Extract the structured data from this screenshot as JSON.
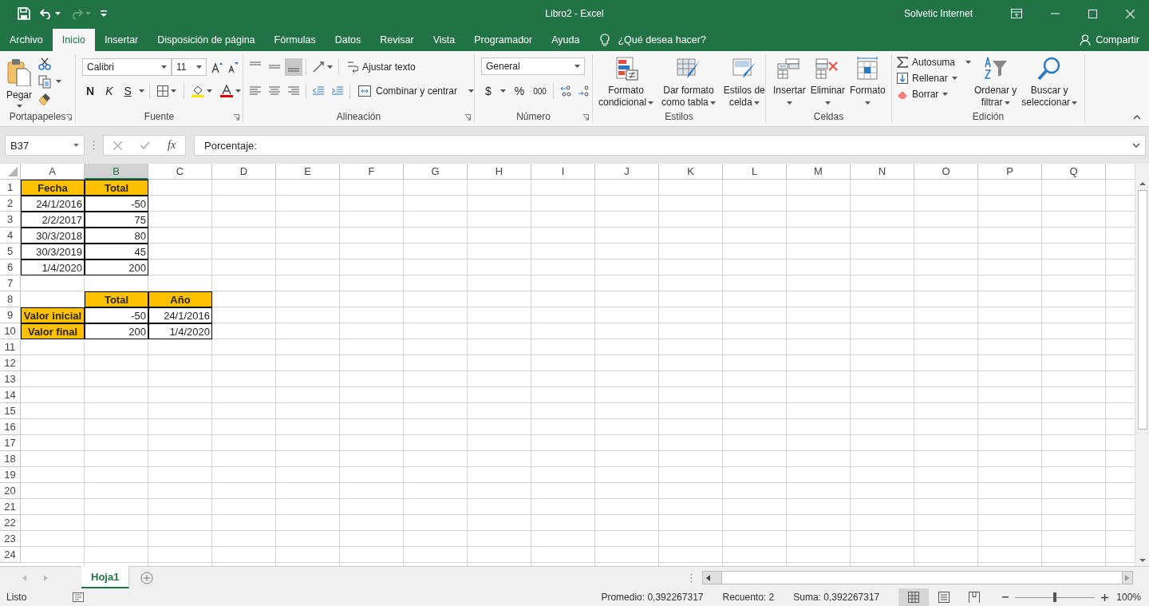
{
  "title_bar": {
    "title": "Libro2  -  Excel",
    "user": "Solvetic Internet",
    "redo_disabled": true
  },
  "menu_tabs": [
    {
      "label": "Archivo",
      "selected": false
    },
    {
      "label": "Inicio",
      "selected": true
    },
    {
      "label": "Insertar",
      "selected": false
    },
    {
      "label": "Disposición de página",
      "selected": false
    },
    {
      "label": "Fórmulas",
      "selected": false
    },
    {
      "label": "Datos",
      "selected": false
    },
    {
      "label": "Revisar",
      "selected": false
    },
    {
      "label": "Vista",
      "selected": false
    },
    {
      "label": "Programador",
      "selected": false
    },
    {
      "label": "Ayuda",
      "selected": false
    }
  ],
  "tell_me": {
    "placeholder": "¿Qué desea hacer?"
  },
  "share": "Compartir",
  "ribbon": {
    "groups": [
      {
        "kind": "clipboard",
        "label": "Portapapeles",
        "launcher": true,
        "paste": "Pegar"
      },
      {
        "kind": "font",
        "label": "Fuente",
        "launcher": true,
        "font_name": "Calibri",
        "font_size": "11",
        "bold": "N",
        "italic": "K",
        "underline": "S"
      },
      {
        "kind": "alignment",
        "label": "Alineación",
        "launcher": true,
        "vertical_align": [
          {
            "selected": false
          },
          {
            "selected": false
          },
          {
            "selected": true
          }
        ],
        "wrap": "Ajustar texto",
        "merge": "Combinar y centrar"
      },
      {
        "kind": "number",
        "label": "Número",
        "launcher": true,
        "format": "General",
        "currency": "$",
        "percent": "%",
        "thousands": "000"
      },
      {
        "kind": "styles",
        "label": "Estilos",
        "launcher": false,
        "buttons": [
          {
            "lines": [
              "Formato",
              "condicional"
            ]
          },
          {
            "lines": [
              "Dar formato",
              "como tabla"
            ]
          },
          {
            "lines": [
              "Estilos de",
              "celda"
            ]
          }
        ]
      },
      {
        "kind": "cells",
        "label": "Celdas",
        "launcher": false,
        "buttons": [
          {
            "lines": [
              "Insertar"
            ]
          },
          {
            "lines": [
              "Eliminar"
            ]
          },
          {
            "lines": [
              "Formato"
            ]
          }
        ]
      },
      {
        "kind": "editing",
        "label": "Edición",
        "launcher": false,
        "small": [
          "Autosuma",
          "Rellenar",
          "Borrar"
        ],
        "buttons": [
          {
            "lines": [
              "Ordenar y",
              "filtrar"
            ]
          },
          {
            "lines": [
              "Buscar y",
              "seleccionar"
            ]
          }
        ]
      }
    ]
  },
  "formula_bar": {
    "name_box": "B37",
    "function_label": "fx",
    "value": "Porcentaje:"
  },
  "grid": {
    "columns": [
      {
        "label": "A",
        "selected": false
      },
      {
        "label": "B",
        "selected": true
      },
      {
        "label": "C",
        "selected": false
      },
      {
        "label": "D",
        "selected": false
      },
      {
        "label": "E",
        "selected": false
      },
      {
        "label": "F",
        "selected": false
      },
      {
        "label": "G",
        "selected": false
      },
      {
        "label": "H",
        "selected": false
      },
      {
        "label": "I",
        "selected": false
      },
      {
        "label": "J",
        "selected": false
      },
      {
        "label": "K",
        "selected": false
      },
      {
        "label": "L",
        "selected": false
      },
      {
        "label": "M",
        "selected": false
      },
      {
        "label": "N",
        "selected": false
      },
      {
        "label": "O",
        "selected": false
      },
      {
        "label": "P",
        "selected": false
      },
      {
        "label": "Q",
        "selected": false
      }
    ],
    "rows": [
      {
        "label": "1",
        "cells": [
          {
            "kind": "heading",
            "text": "Fecha"
          },
          {
            "kind": "heading",
            "text": "Total"
          }
        ]
      },
      {
        "label": "2",
        "cells": [
          {
            "kind": "value",
            "text": "24/1/2016"
          },
          {
            "kind": "value",
            "text": "-50"
          }
        ]
      },
      {
        "label": "3",
        "cells": [
          {
            "kind": "value",
            "text": "2/2/2017"
          },
          {
            "kind": "value",
            "text": "75"
          }
        ]
      },
      {
        "label": "4",
        "cells": [
          {
            "kind": "value",
            "text": "30/3/2018"
          },
          {
            "kind": "value",
            "text": "80"
          }
        ]
      },
      {
        "label": "5",
        "cells": [
          {
            "kind": "value",
            "text": "30/3/2019"
          },
          {
            "kind": "value",
            "text": "45"
          }
        ]
      },
      {
        "label": "6",
        "cells": [
          {
            "kind": "value",
            "text": "1/4/2020"
          },
          {
            "kind": "value",
            "text": "200"
          }
        ]
      },
      {
        "label": "7",
        "cells": []
      },
      {
        "label": "8",
        "cells": [
          {
            "kind": "empty"
          },
          {
            "kind": "heading",
            "text": "Total"
          },
          {
            "kind": "heading",
            "text": "Año"
          }
        ]
      },
      {
        "label": "9",
        "cells": [
          {
            "kind": "heading",
            "text": "Valor inicial"
          },
          {
            "kind": "value",
            "text": "-50"
          },
          {
            "kind": "value",
            "text": "24/1/2016"
          }
        ]
      },
      {
        "label": "10",
        "cells": [
          {
            "kind": "heading",
            "text": "Valor final"
          },
          {
            "kind": "value",
            "text": "200"
          },
          {
            "kind": "value",
            "text": "1/4/2020"
          }
        ]
      },
      {
        "label": "11",
        "cells": []
      },
      {
        "label": "12",
        "cells": []
      },
      {
        "label": "13",
        "cells": []
      },
      {
        "label": "14",
        "cells": []
      },
      {
        "label": "15",
        "cells": []
      },
      {
        "label": "16",
        "cells": []
      },
      {
        "label": "17",
        "cells": []
      },
      {
        "label": "18",
        "cells": []
      },
      {
        "label": "19",
        "cells": []
      },
      {
        "label": "20",
        "cells": []
      },
      {
        "label": "21",
        "cells": []
      },
      {
        "label": "22",
        "cells": []
      },
      {
        "label": "23",
        "cells": []
      },
      {
        "label": "24",
        "cells": []
      }
    ]
  },
  "sheet_tabs": [
    {
      "label": "Hoja1",
      "selected": true
    }
  ],
  "status_bar": {
    "status": "Listo",
    "stats": [
      "Promedio: 0,392267317",
      "Recuento: 2",
      "Suma: 0,392267317"
    ],
    "views": [
      {
        "selected": true
      },
      {
        "selected": false
      },
      {
        "selected": false
      }
    ],
    "zoom": {
      "level": 0.5,
      "text": "100%"
    }
  }
}
